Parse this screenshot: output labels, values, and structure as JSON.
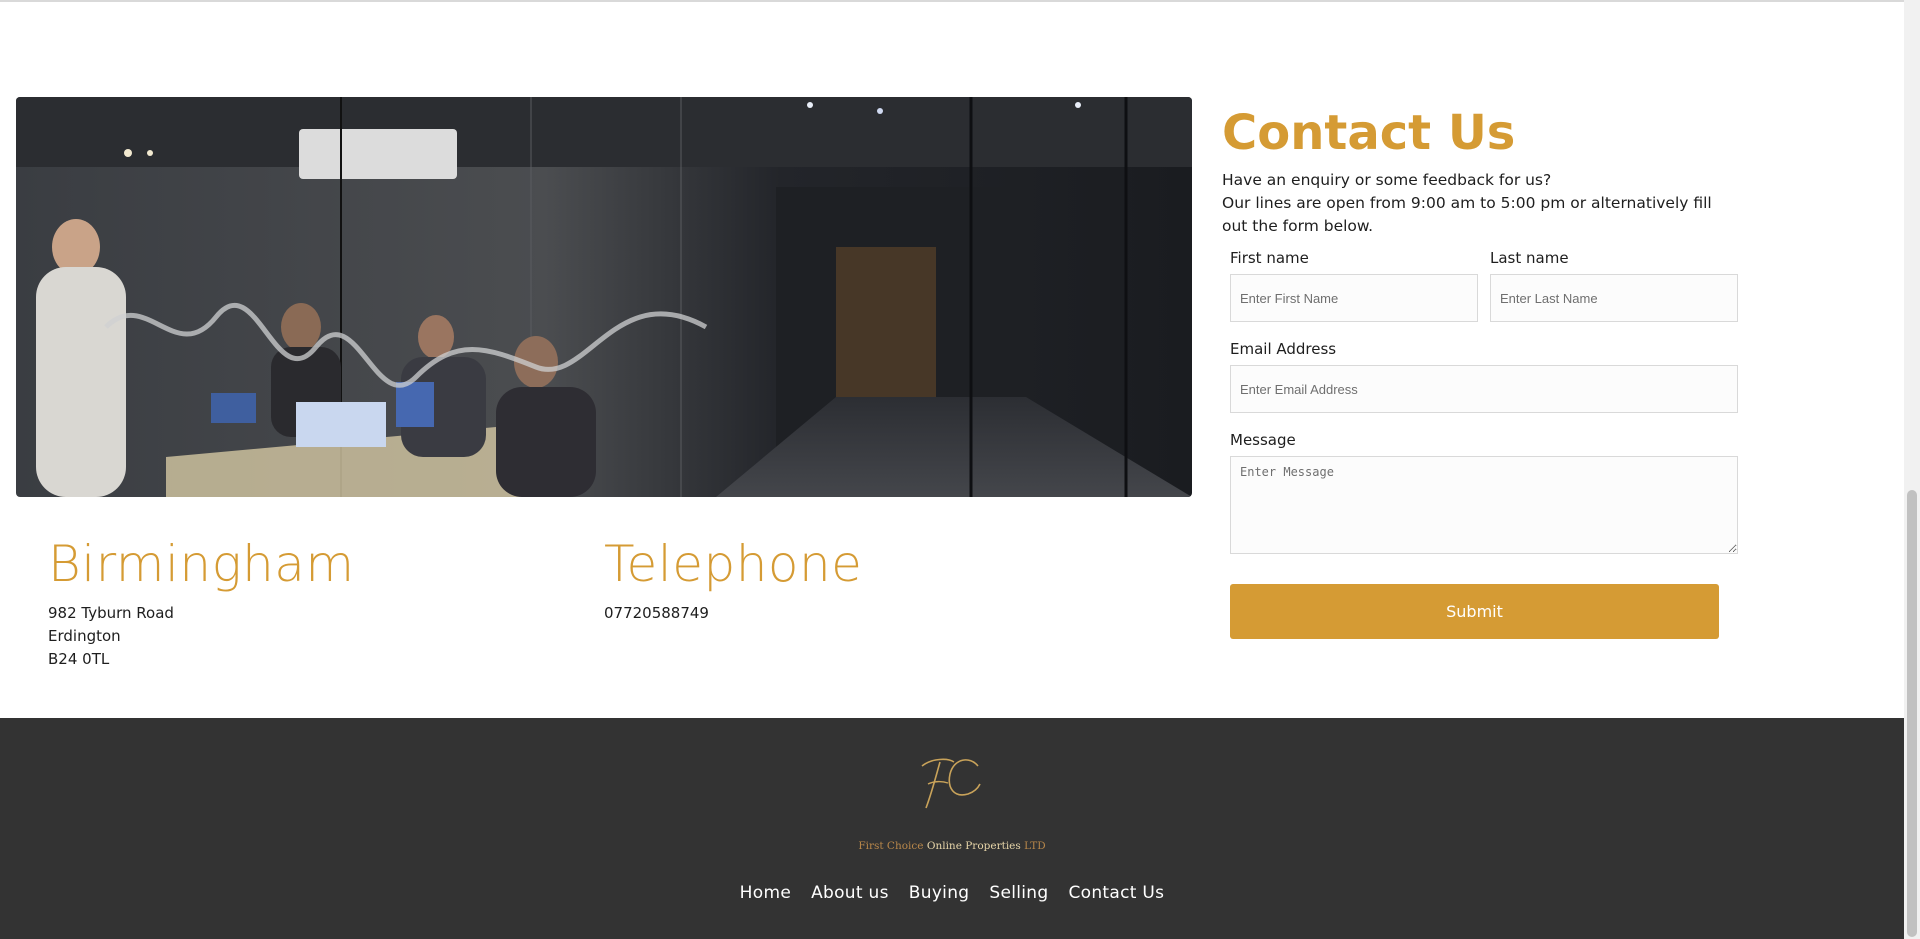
{
  "contact": {
    "title": "Contact Us",
    "intro_line1": "Have an enquiry or some feedback for us?",
    "intro_line2": "Our lines are open from 9:00 am to 5:00 pm or alternatively fill out the form below."
  },
  "form": {
    "first_name_label": "First name",
    "first_name_placeholder": "Enter First Name",
    "last_name_label": "Last name",
    "last_name_placeholder": "Enter Last Name",
    "email_label": "Email Address",
    "email_placeholder": "Enter Email Address",
    "message_label": "Message",
    "message_placeholder": "Enter Message",
    "submit_label": "Submit"
  },
  "locations": {
    "birmingham": {
      "title": "Birmingham",
      "lines": [
        "982 Tyburn Road",
        "Erdington",
        "B24 0TL"
      ]
    },
    "telephone": {
      "title": "Telephone",
      "number": "07720588749"
    }
  },
  "footer": {
    "company_part1": "First Choice",
    "company_part2": "Online Properties",
    "company_part3": "LTD",
    "nav": [
      "Home",
      "About us",
      "Buying",
      "Selling",
      "Contact Us"
    ]
  },
  "colors": {
    "accent": "#d59b34",
    "footer_bg": "#333333"
  },
  "icons": {
    "logo": "fc-monogram-logo"
  }
}
